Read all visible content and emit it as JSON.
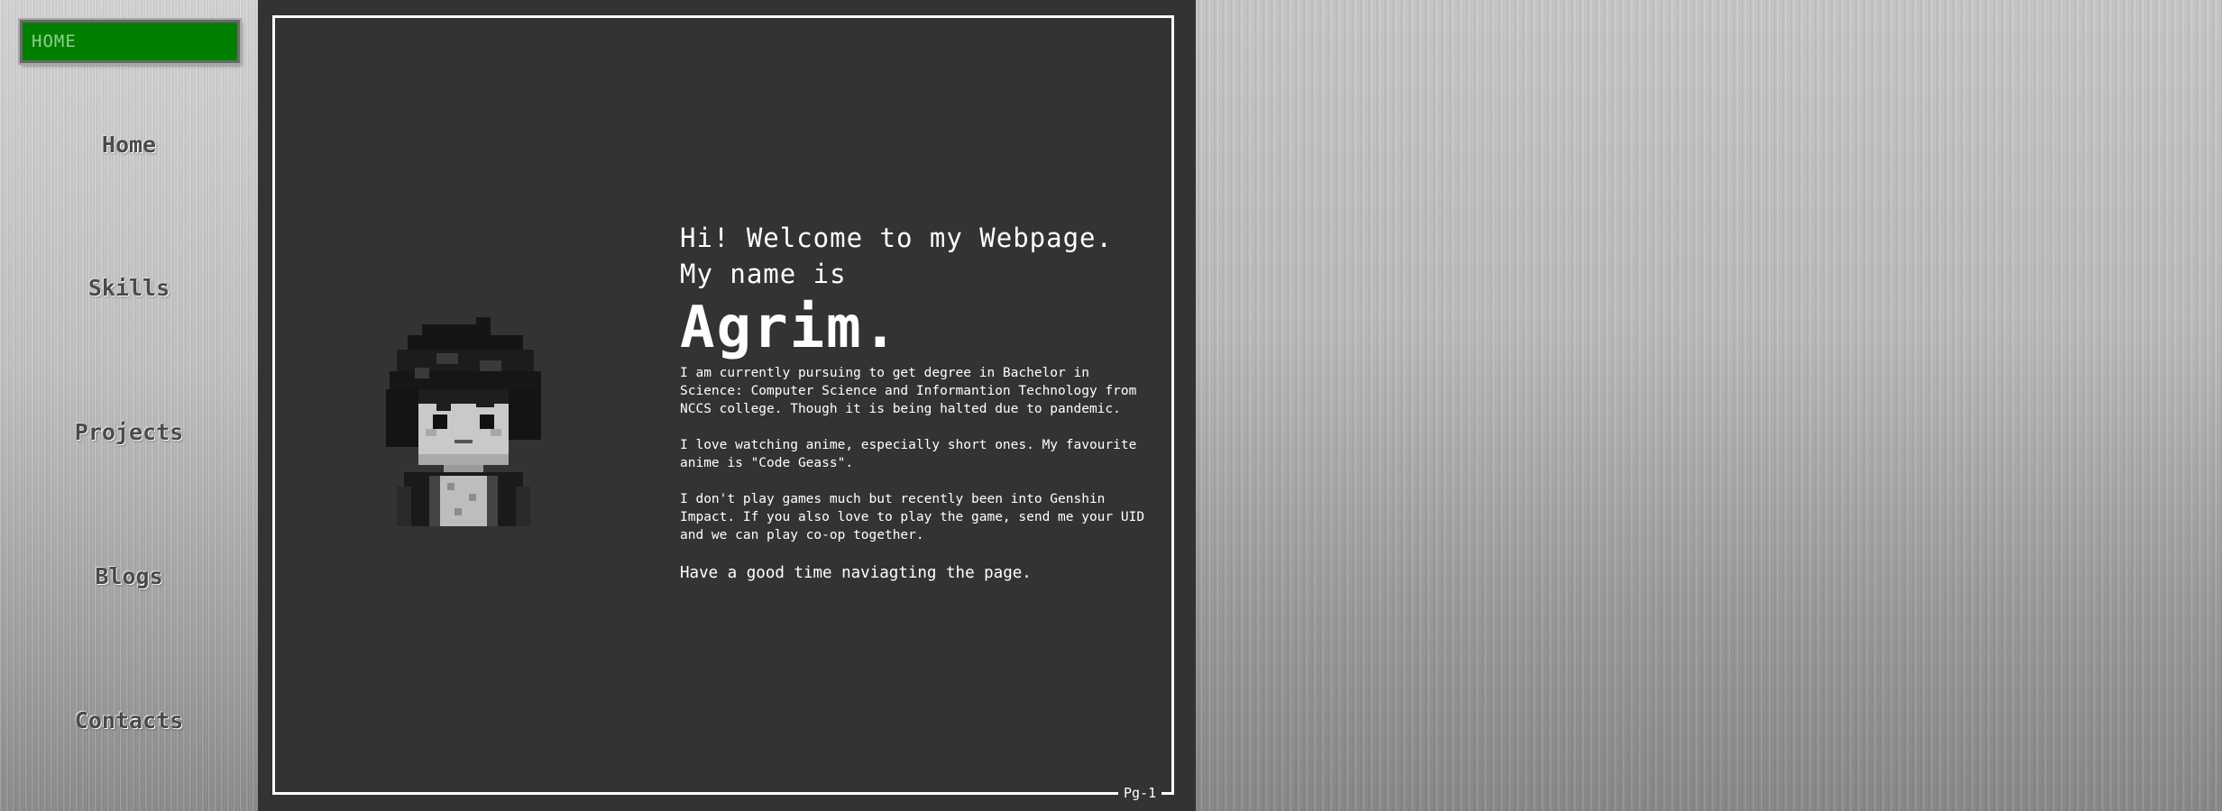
{
  "sidebar": {
    "current_page": "HOME",
    "items": [
      {
        "label": "Home"
      },
      {
        "label": "Skills"
      },
      {
        "label": "Projects"
      },
      {
        "label": "Blogs"
      },
      {
        "label": "Contacts"
      }
    ]
  },
  "content": {
    "greeting": "Hi! Welcome to my Webpage. My name is",
    "name": "Agrim.",
    "paragraphs": [
      "I am currently pursuing to get degree in Bachelor in Science: Computer Science and Informantion Technology from NCCS college. Though it is being halted due to pandemic.",
      "I love watching anime, especially short ones. My favourite anime is \"Code Geass\".",
      "I don't play games much but recently been into Genshin Impact. If you also love to play the game, send me your UID and we can play co-op together."
    ],
    "closing": "Have a good time naviagting the page.",
    "page_label": "Pg-1"
  },
  "colors": {
    "panel_background": "#333333",
    "active_indicator": "#007f00",
    "text": "#ffffff"
  },
  "icons": {
    "avatar": "pixel-art-avatar-icon"
  }
}
